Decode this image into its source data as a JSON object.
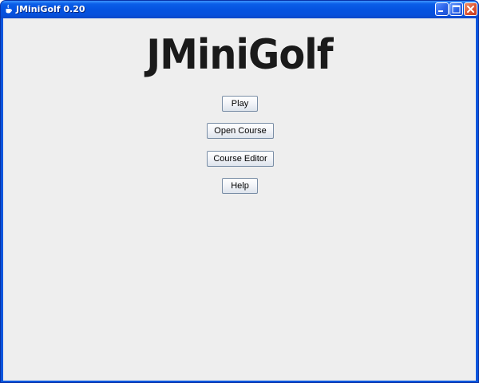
{
  "window": {
    "title": "JMiniGolf 0.20",
    "app_icon": "java-cup-icon",
    "controls": {
      "minimize_icon": "minimize-icon",
      "maximize_icon": "maximize-icon",
      "close_icon": "close-icon"
    }
  },
  "main": {
    "heading": "JMiniGolf",
    "buttons": {
      "play": "Play",
      "open_course": "Open Course",
      "course_editor": "Course Editor",
      "help": "Help"
    }
  },
  "colors": {
    "titlebar": "#0553e0",
    "close_button": "#dd5433",
    "client_background": "#eeeeee",
    "heading_text": "#1a1a1a"
  }
}
